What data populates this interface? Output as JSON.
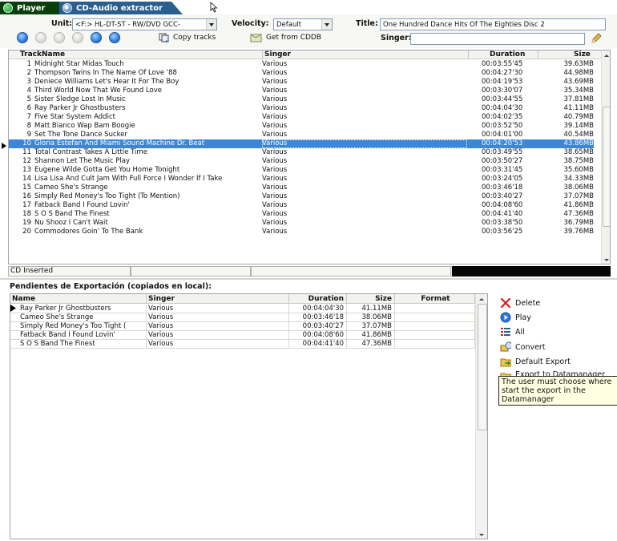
{
  "tabs": {
    "player": "Player",
    "cd_audio": "CD-Audio extractor"
  },
  "toolbar": {
    "unit_label": "Unit:",
    "unit_value": "<F:> HL-DT-ST - RW/DVD GCC-",
    "velocity_label": "Velocity:",
    "velocity_value": "Default",
    "title_label": "Title:",
    "title_value": "One Hundred Dance Hits Of The Eighties Disc 2",
    "singer_label": "Singer:",
    "singer_value": "",
    "copy_tracks": "Copy tracks",
    "get_cddb": "Get from CDDB"
  },
  "track_table": {
    "headers": {
      "track": "Track",
      "name": "Name",
      "singer": "Singer",
      "duration": "Duration",
      "size": "Size"
    },
    "rows": [
      {
        "num": "1",
        "name": "Midnight Star  Midas Touch",
        "singer": "Various",
        "duration": "00:03:55'45",
        "size": "39.63MB"
      },
      {
        "num": "2",
        "name": "Thompson Twins  In The Name Of Love '88",
        "singer": "Various",
        "duration": "00:04:27'30",
        "size": "44.98MB"
      },
      {
        "num": "3",
        "name": "Deniece Williams  Let's Hear It For The Boy",
        "singer": "Various",
        "duration": "00:04:19'53",
        "size": "43.69MB"
      },
      {
        "num": "4",
        "name": "Third World  Now That We Found Love",
        "singer": "Various",
        "duration": "00:03:30'07",
        "size": "35.34MB"
      },
      {
        "num": "5",
        "name": "Sister Sledge  Lost In Music",
        "singer": "Various",
        "duration": "00:03:44'55",
        "size": "37.81MB"
      },
      {
        "num": "6",
        "name": "Ray Parker Jr  Ghostbusters",
        "singer": "Various",
        "duration": "00:04:04'30",
        "size": "41.11MB"
      },
      {
        "num": "7",
        "name": "Five Star  System Addict",
        "singer": "Various",
        "duration": "00:04:02'35",
        "size": "40.79MB"
      },
      {
        "num": "8",
        "name": "Matt Bianco  Wap Bam Boogie",
        "singer": "Various",
        "duration": "00:03:52'50",
        "size": "39.14MB"
      },
      {
        "num": "9",
        "name": "Set The Tone  Dance Sucker",
        "singer": "Various",
        "duration": "00:04:01'00",
        "size": "40.54MB"
      },
      {
        "num": "10",
        "name": "Gloria Estefan And Miami Sound Machine  Dr. Beat",
        "singer": "Various",
        "duration": "00:04:20'53",
        "size": "43.86MB"
      },
      {
        "num": "11",
        "name": "Total Contrast  Takes A Little Time",
        "singer": "Various",
        "duration": "00:03:49'55",
        "size": "38.65MB"
      },
      {
        "num": "12",
        "name": "Shannon  Let The Music Play",
        "singer": "Various",
        "duration": "00:03:50'27",
        "size": "38.75MB"
      },
      {
        "num": "13",
        "name": "Eugene Wilde  Gotta Get You Home Tonight",
        "singer": "Various",
        "duration": "00:03:31'45",
        "size": "35.60MB"
      },
      {
        "num": "14",
        "name": "Lisa Lisa And Cult Jam With Full Force  I Wonder If I Take",
        "singer": "Various",
        "duration": "00:03:24'05",
        "size": "34.33MB"
      },
      {
        "num": "15",
        "name": "Cameo  She's Strange",
        "singer": "Various",
        "duration": "00:03:46'18",
        "size": "38.06MB"
      },
      {
        "num": "16",
        "name": "Simply Red  Money's Too Tight (To Mention)",
        "singer": "Various",
        "duration": "00:03:40'27",
        "size": "37.07MB"
      },
      {
        "num": "17",
        "name": "Fatback Band  I Found Lovin'",
        "singer": "Various",
        "duration": "00:04:08'60",
        "size": "41.86MB"
      },
      {
        "num": "18",
        "name": "S O S  Band  The Finest",
        "singer": "Various",
        "duration": "00:04:41'40",
        "size": "47.36MB"
      },
      {
        "num": "19",
        "name": "Nu Shooz  I Can't Wait",
        "singer": "Various",
        "duration": "00:03:38'50",
        "size": "36.79MB"
      },
      {
        "num": "20",
        "name": "Commodores  Goin' To The Bank",
        "singer": "Various",
        "duration": "00:03:56'25",
        "size": "39.76MB"
      }
    ]
  },
  "status": {
    "text": "CD Inserted"
  },
  "export": {
    "title": "Pendientes de Exportación (copiados en local):",
    "headers": {
      "name": "Name",
      "singer": "Singer",
      "duration": "Duration",
      "size": "Size",
      "format": "Format"
    },
    "rows": [
      {
        "name": "Ray Parker Jr  Ghostbusters",
        "singer": "Various",
        "duration": "00:04:04'30",
        "size": "41.11MB",
        "format": ""
      },
      {
        "name": "Cameo  She's Strange",
        "singer": "Various",
        "duration": "00:03:46'18",
        "size": "38.06MB",
        "format": ""
      },
      {
        "name": "Simply Red  Money's Too Tight (",
        "singer": "Various",
        "duration": "00:03:40'27",
        "size": "37.07MB",
        "format": ""
      },
      {
        "name": "Fatback Band  I Found Lovin'",
        "singer": "Various",
        "duration": "00:04:08'60",
        "size": "41.86MB",
        "format": ""
      },
      {
        "name": "S O S  Band  The Finest",
        "singer": "Various",
        "duration": "00:04:41'40",
        "size": "47.36MB",
        "format": ""
      }
    ]
  },
  "actions": {
    "delete": "Delete",
    "play": "Play",
    "all": "All",
    "convert": "Convert",
    "default_export": "Default Export",
    "export_datamanager": "Export to Datamanager"
  },
  "tooltip": {
    "text": "The user must choose where start the export in the Datamanager"
  },
  "colors": {
    "selection": "#3b86d8",
    "tab_player": "#0a3f0d",
    "tab_cd": "#2a5e8f",
    "tooltip_bg": "#ffffe1"
  }
}
